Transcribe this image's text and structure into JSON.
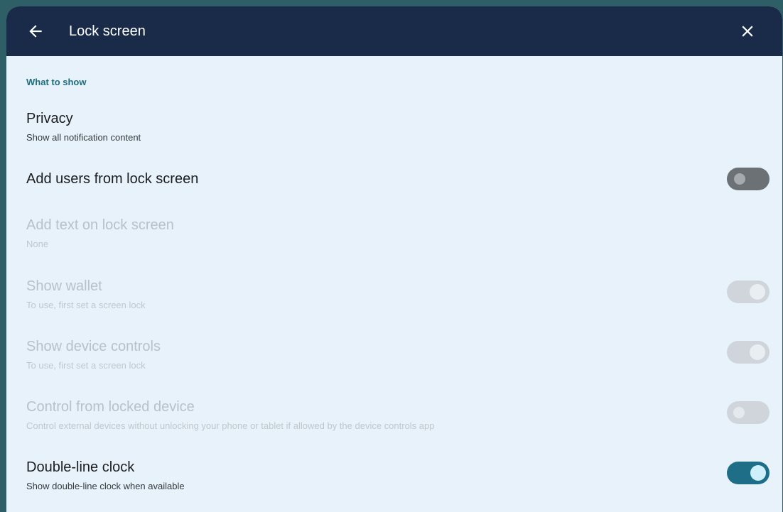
{
  "header": {
    "title": "Lock screen",
    "back_icon": "arrow-left-icon",
    "close_icon": "close-icon"
  },
  "section": {
    "label": "What to show"
  },
  "settings": [
    {
      "title": "Privacy",
      "summary": "Show all notification content",
      "enabled": true,
      "toggle": null
    },
    {
      "title": "Add users from lock screen",
      "summary": "",
      "enabled": true,
      "toggle": "off"
    },
    {
      "title": "Add text on lock screen",
      "summary": "None",
      "enabled": false,
      "toggle": null
    },
    {
      "title": "Show wallet",
      "summary": "To use, first set a screen lock",
      "enabled": false,
      "toggle": "on"
    },
    {
      "title": "Show device controls",
      "summary": "To use, first set a screen lock",
      "enabled": false,
      "toggle": "on"
    },
    {
      "title": "Control from locked device",
      "summary": "Control external devices without unlocking your phone or tablet if allowed by the device controls app",
      "enabled": false,
      "toggle": "off"
    },
    {
      "title": "Double-line clock",
      "summary": "Show double-line clock when available",
      "enabled": true,
      "toggle": "on"
    }
  ],
  "colors": {
    "header_bg": "#192b48",
    "page_bg": "#e7f2fa",
    "accent": "#1f6e87",
    "section_label": "#1f6e7e"
  }
}
